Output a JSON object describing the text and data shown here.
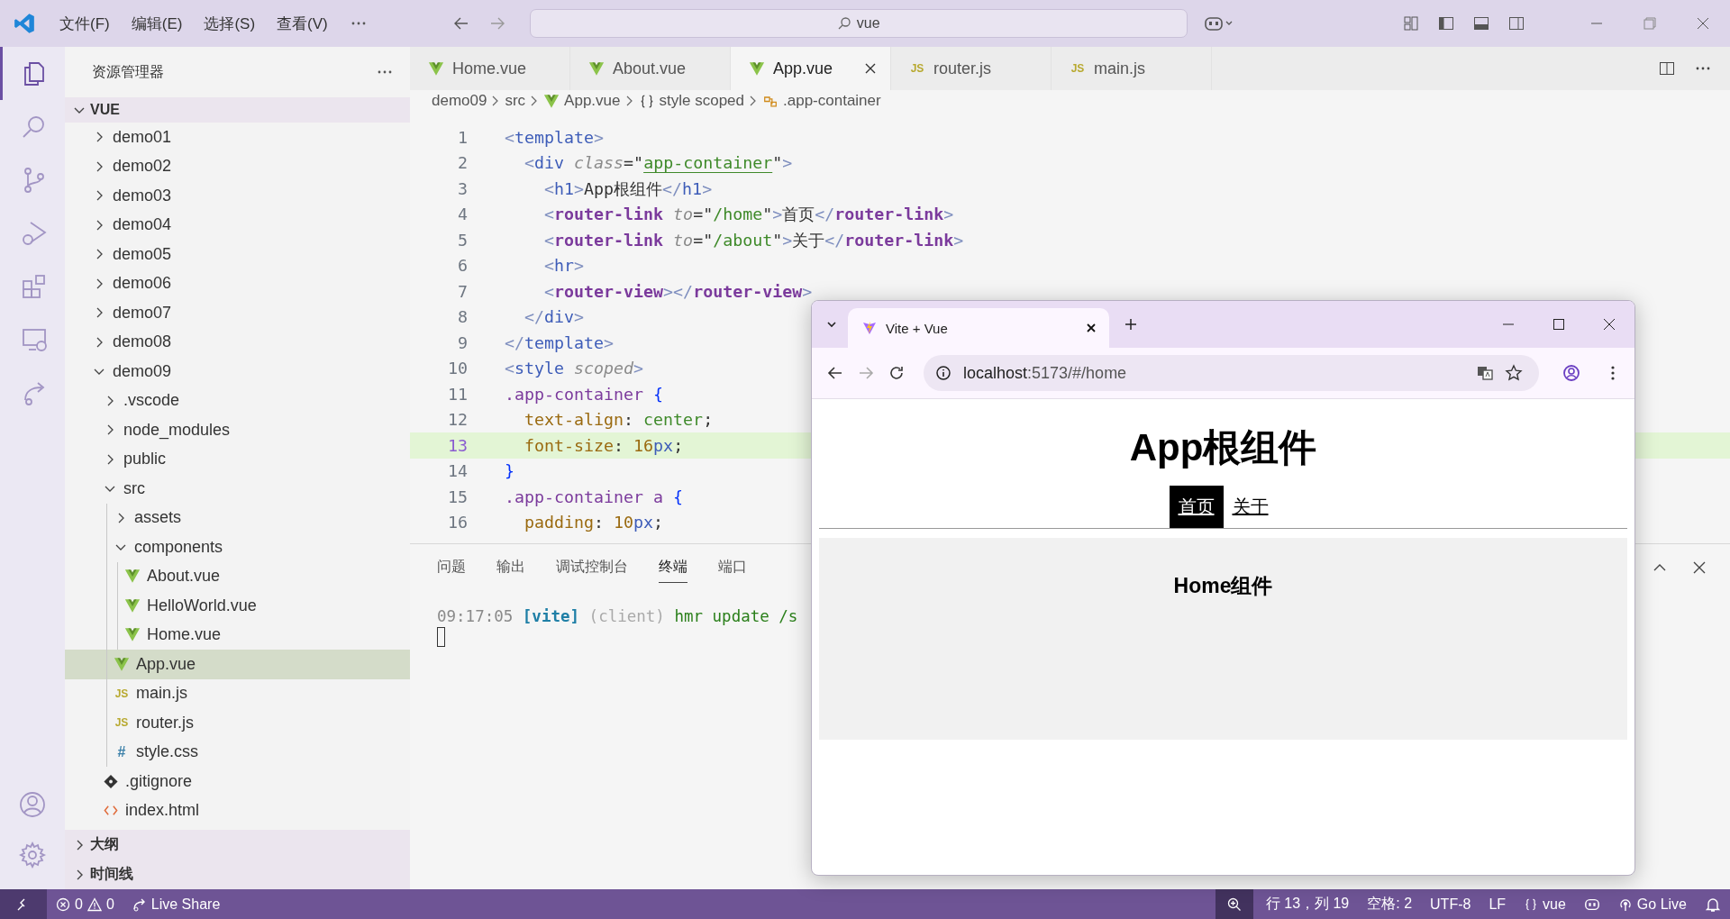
{
  "title_bar": {
    "menus": [
      "文件(F)",
      "编辑(E)",
      "选择(S)",
      "查看(V)"
    ],
    "search": {
      "value": "vue"
    }
  },
  "activity_bar": [
    {
      "kind": "files",
      "selected": true
    },
    {
      "kind": "search",
      "selected": false
    },
    {
      "kind": "git",
      "selected": false
    },
    {
      "kind": "debug",
      "selected": false
    },
    {
      "kind": "extensions",
      "selected": false
    },
    {
      "kind": "remote",
      "selected": false
    },
    {
      "kind": "share",
      "selected": false
    }
  ],
  "explorer": {
    "title": "资源管理器",
    "root": {
      "label": "VUE",
      "expanded": true
    },
    "tree": [
      {
        "name": "demo01",
        "kind": "folder",
        "expanded": false,
        "selected": false
      },
      {
        "name": "demo02",
        "kind": "folder",
        "expanded": false,
        "selected": false
      },
      {
        "name": "demo03",
        "kind": "folder",
        "expanded": false,
        "selected": false
      },
      {
        "name": "demo04",
        "kind": "folder",
        "expanded": false,
        "selected": false
      },
      {
        "name": "demo05",
        "kind": "folder",
        "expanded": false,
        "selected": false
      },
      {
        "name": "demo06",
        "kind": "folder",
        "expanded": false,
        "selected": false
      },
      {
        "name": "demo07",
        "kind": "folder",
        "expanded": false,
        "selected": false
      },
      {
        "name": "demo08",
        "kind": "folder",
        "expanded": false,
        "selected": false
      },
      {
        "name": "demo09",
        "kind": "folder",
        "expanded": true,
        "selected": false,
        "children": [
          {
            "name": ".vscode",
            "kind": "folder",
            "expanded": false,
            "selected": false
          },
          {
            "name": "node_modules",
            "kind": "folder",
            "expanded": false,
            "selected": false
          },
          {
            "name": "public",
            "kind": "folder",
            "expanded": false,
            "selected": false
          },
          {
            "name": "src",
            "kind": "folder",
            "expanded": true,
            "selected": false,
            "children": [
              {
                "name": "assets",
                "kind": "folder",
                "expanded": false,
                "selected": false
              },
              {
                "name": "components",
                "kind": "folder",
                "expanded": true,
                "selected": false,
                "children": [
                  {
                    "name": "About.vue",
                    "kind": "vue",
                    "selected": false
                  },
                  {
                    "name": "HelloWorld.vue",
                    "kind": "vue",
                    "selected": false
                  },
                  {
                    "name": "Home.vue",
                    "kind": "vue",
                    "selected": false
                  }
                ]
              },
              {
                "name": "App.vue",
                "kind": "vue",
                "selected": true
              },
              {
                "name": "main.js",
                "kind": "js",
                "badge": "JS",
                "selected": false
              },
              {
                "name": "router.js",
                "kind": "js",
                "badge": "JS",
                "selected": false
              },
              {
                "name": "style.css",
                "kind": "css",
                "badge": "#",
                "selected": false
              }
            ]
          },
          {
            "name": ".gitignore",
            "kind": "git",
            "selected": false
          },
          {
            "name": "index.html",
            "kind": "html",
            "selected": false
          }
        ]
      }
    ],
    "sections": [
      {
        "label": "大纲",
        "expanded": false
      },
      {
        "label": "时间线",
        "expanded": false
      }
    ]
  },
  "editor_tabs": [
    {
      "label": "Home.vue",
      "kind": "vue",
      "selected": false
    },
    {
      "label": "About.vue",
      "kind": "vue",
      "selected": false
    },
    {
      "label": "App.vue",
      "kind": "vue",
      "selected": true
    },
    {
      "label": "router.js",
      "kind": "js",
      "badge": "JS",
      "selected": false
    },
    {
      "label": "main.js",
      "kind": "js",
      "badge": "JS",
      "selected": false
    }
  ],
  "breadcrumb": [
    {
      "label": "demo09",
      "kind": "folder"
    },
    {
      "label": "src",
      "kind": "folder"
    },
    {
      "label": "App.vue",
      "kind": "vue"
    },
    {
      "label": "style scoped",
      "kind": "braces"
    },
    {
      "label": ".app-container",
      "kind": "class"
    }
  ],
  "code": [
    {
      "number": "1",
      "current": false,
      "tokens": [
        {
          "t": "<",
          "kind": "punct"
        },
        {
          "t": "template",
          "kind": "tag"
        },
        {
          "t": ">",
          "kind": "punct"
        }
      ]
    },
    {
      "number": "2",
      "current": false,
      "tokens": [
        {
          "t": "  <",
          "kind": "punct"
        },
        {
          "t": "div",
          "kind": "tag"
        },
        {
          "t": " class",
          "kind": "attr"
        },
        {
          "t": "=\"",
          "kind": "text"
        },
        {
          "t": "app-container",
          "kind": "link"
        },
        {
          "t": "\"",
          "kind": "text"
        },
        {
          "t": ">",
          "kind": "punct"
        }
      ]
    },
    {
      "number": "3",
      "current": false,
      "tokens": [
        {
          "t": "    <",
          "kind": "punct"
        },
        {
          "t": "h1",
          "kind": "tag"
        },
        {
          "t": ">",
          "kind": "punct"
        },
        {
          "t": "App根组件",
          "kind": "text"
        },
        {
          "t": "</",
          "kind": "punct"
        },
        {
          "t": "h1",
          "kind": "tag"
        },
        {
          "t": ">",
          "kind": "punct"
        }
      ]
    },
    {
      "number": "4",
      "current": false,
      "tokens": [
        {
          "t": "    <",
          "kind": "punct"
        },
        {
          "t": "router-link",
          "kind": "component"
        },
        {
          "t": " to",
          "kind": "attr"
        },
        {
          "t": "=\"",
          "kind": "text"
        },
        {
          "t": "/home",
          "kind": "string"
        },
        {
          "t": "\"",
          "kind": "text"
        },
        {
          "t": ">",
          "kind": "punct"
        },
        {
          "t": "首页",
          "kind": "text"
        },
        {
          "t": "</",
          "kind": "punct"
        },
        {
          "t": "router-link",
          "kind": "component"
        },
        {
          "t": ">",
          "kind": "punct"
        }
      ]
    },
    {
      "number": "5",
      "current": false,
      "tokens": [
        {
          "t": "    <",
          "kind": "punct"
        },
        {
          "t": "router-link",
          "kind": "component"
        },
        {
          "t": " to",
          "kind": "attr"
        },
        {
          "t": "=\"",
          "kind": "text"
        },
        {
          "t": "/about",
          "kind": "string"
        },
        {
          "t": "\"",
          "kind": "text"
        },
        {
          "t": ">",
          "kind": "punct"
        },
        {
          "t": "关于",
          "kind": "text"
        },
        {
          "t": "</",
          "kind": "punct"
        },
        {
          "t": "router-link",
          "kind": "component"
        },
        {
          "t": ">",
          "kind": "punct"
        }
      ]
    },
    {
      "number": "6",
      "current": false,
      "tokens": [
        {
          "t": "    <",
          "kind": "punct"
        },
        {
          "t": "hr",
          "kind": "tag"
        },
        {
          "t": ">",
          "kind": "punct"
        }
      ]
    },
    {
      "number": "7",
      "current": false,
      "tokens": [
        {
          "t": "    <",
          "kind": "punct"
        },
        {
          "t": "router-view",
          "kind": "component"
        },
        {
          "t": "></",
          "kind": "punct"
        },
        {
          "t": "router-view",
          "kind": "component"
        },
        {
          "t": ">",
          "kind": "punct"
        }
      ]
    },
    {
      "number": "8",
      "current": false,
      "tokens": [
        {
          "t": "  </",
          "kind": "punct"
        },
        {
          "t": "div",
          "kind": "tag"
        },
        {
          "t": ">",
          "kind": "punct"
        }
      ]
    },
    {
      "number": "9",
      "current": false,
      "tokens": [
        {
          "t": "</",
          "kind": "punct"
        },
        {
          "t": "template",
          "kind": "tag"
        },
        {
          "t": ">",
          "kind": "punct"
        }
      ]
    },
    {
      "number": "10",
      "current": false,
      "tokens": [
        {
          "t": "<",
          "kind": "punct"
        },
        {
          "t": "style",
          "kind": "tag"
        },
        {
          "t": " scoped",
          "kind": "attr"
        },
        {
          "t": ">",
          "kind": "punct"
        }
      ]
    },
    {
      "number": "11",
      "current": false,
      "tokens": [
        {
          "t": ".app-container",
          "kind": "selector"
        },
        {
          "t": " {",
          "kind": "brace"
        }
      ]
    },
    {
      "number": "12",
      "current": false,
      "tokens": [
        {
          "t": "  text-align",
          "kind": "property"
        },
        {
          "t": ": ",
          "kind": "text"
        },
        {
          "t": "center",
          "kind": "value"
        },
        {
          "t": ";",
          "kind": "text"
        }
      ]
    },
    {
      "number": "13",
      "current": true,
      "tokens": [
        {
          "t": "  font-size",
          "kind": "property"
        },
        {
          "t": ": ",
          "kind": "text"
        },
        {
          "t": "16",
          "kind": "number"
        },
        {
          "t": "px",
          "kind": "unit"
        },
        {
          "t": ";",
          "kind": "text"
        }
      ]
    },
    {
      "number": "14",
      "current": false,
      "tokens": [
        {
          "t": "}",
          "kind": "brace"
        }
      ]
    },
    {
      "number": "15",
      "current": false,
      "tokens": [
        {
          "t": ".app-container a",
          "kind": "selector"
        },
        {
          "t": " {",
          "kind": "brace"
        }
      ]
    },
    {
      "number": "16",
      "current": false,
      "tokens": [
        {
          "t": "  padding",
          "kind": "property"
        },
        {
          "t": ": ",
          "kind": "text"
        },
        {
          "t": "10",
          "kind": "number"
        },
        {
          "t": "px",
          "kind": "unit"
        },
        {
          "t": ";",
          "kind": "text"
        }
      ]
    }
  ],
  "panel": {
    "tabs": [
      {
        "label": "问题",
        "selected": false
      },
      {
        "label": "输出",
        "selected": false
      },
      {
        "label": "调试控制台",
        "selected": false
      },
      {
        "label": "终端",
        "selected": true
      },
      {
        "label": "端口",
        "selected": false
      }
    ],
    "terminal": [
      {
        "t": "09:17:05",
        "kind": "time"
      },
      {
        "t": " [vite]",
        "kind": "tag"
      },
      {
        "t": " (client)",
        "kind": "dim"
      },
      {
        "t": " hmr update /s",
        "kind": "ok"
      }
    ]
  },
  "browser": {
    "tab": {
      "title": "Vite + Vue"
    },
    "url": {
      "host": "localhost",
      "rest": ":5173/#/home"
    },
    "page": {
      "heading": "App根组件",
      "links": [
        {
          "label": "首页",
          "selected": true
        },
        {
          "label": "关于",
          "selected": false
        }
      ],
      "view_heading": "Home组件"
    }
  },
  "status_bar": {
    "errors": "0",
    "warnings": "0",
    "live_share": "Live Share",
    "position": "行 13，列 19",
    "spaces": "空格: 2",
    "encoding": "UTF-8",
    "eol": "LF",
    "language": "vue",
    "go_live": "Go Live"
  }
}
